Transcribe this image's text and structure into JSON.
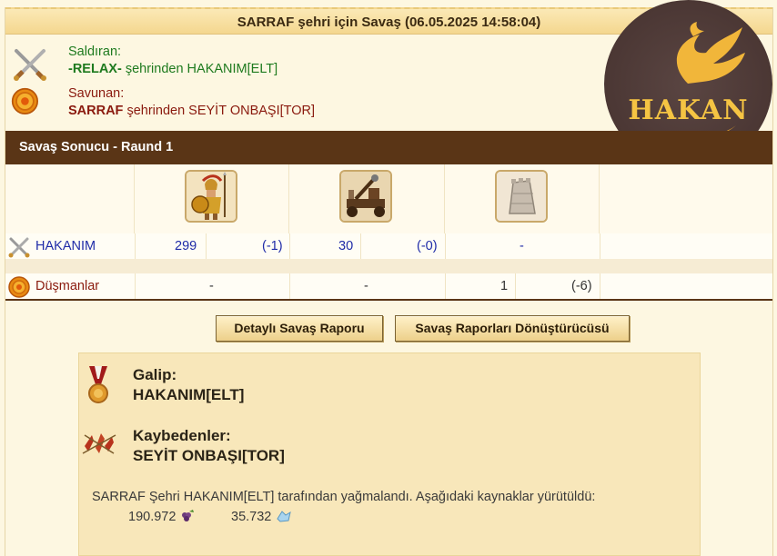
{
  "title": "SARRAF şehri için Savaş (06.05.2025 14:58:04)",
  "attacker": {
    "label": "Saldıran:",
    "city": "-RELAX-",
    "from_text": " şehrinden HAKANIM[ELT]",
    "icon": "crossed-swords-icon"
  },
  "defender": {
    "label": "Savunan:",
    "city": "SARRAF",
    "from_text": " şehrinden SEYİT ONBAŞI[TOR]",
    "icon": "shield-icon"
  },
  "round_title": "Savaş Sonucu - Raund 1",
  "units": [
    "hoplite-icon",
    "catapult-icon",
    "city-wall-icon"
  ],
  "rows": [
    {
      "name": "HAKANIM",
      "cells": [
        {
          "count": "299",
          "loss": "(-1)"
        },
        {
          "count": "30",
          "loss": "(-0)"
        },
        {
          "count": "-",
          "loss": ""
        }
      ]
    },
    {
      "name": "Düşmanlar",
      "cells": [
        {
          "count": "-",
          "loss": ""
        },
        {
          "count": "-",
          "loss": ""
        },
        {
          "count": "1",
          "loss": "(-6)"
        }
      ]
    }
  ],
  "buttons": {
    "detail": "Detaylı Savaş Raporu",
    "converter": "Savaş Raporları Dönüştürücüsü"
  },
  "winner": {
    "label": "Galip:",
    "value": "HAKANIM[ELT]",
    "icon": "medal-icon"
  },
  "losers": {
    "label": "Kaybedenler:",
    "value": "SEYİT ONBAŞI[TOR]",
    "icon": "fallen-soldiers-icon"
  },
  "loot_text": "SARRAF Şehri HAKANIM[ELT] tarafından yağmalandı. Aşağıdaki kaynaklar yürütüldü:",
  "loot": [
    {
      "amount": "190.972",
      "icon": "wine-icon"
    },
    {
      "amount": "35.732",
      "icon": "crystal-icon"
    }
  ],
  "watermark": "HAKAN"
}
